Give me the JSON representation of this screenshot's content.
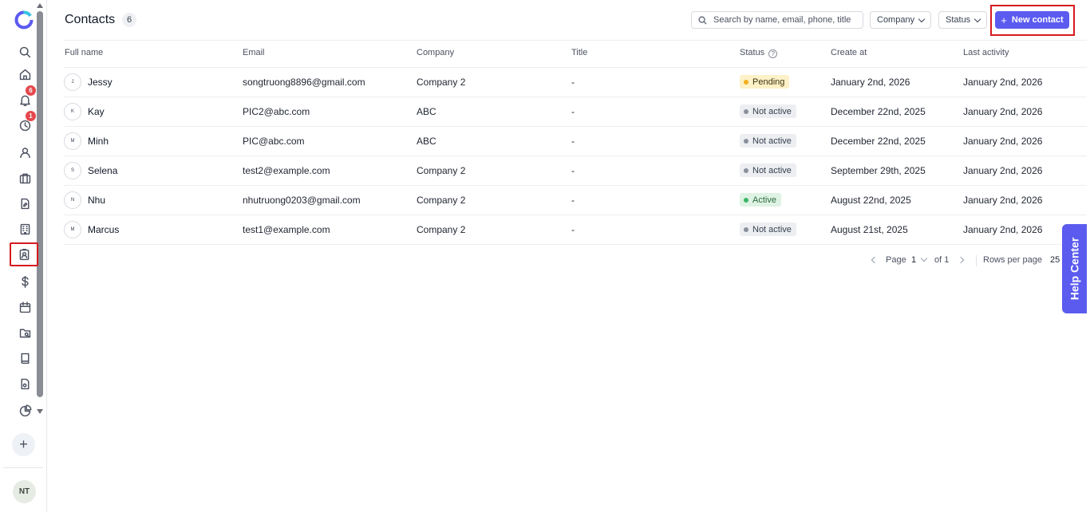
{
  "header": {
    "title": "Contacts",
    "count": "6",
    "search_placeholder": "Search by name, email, phone, title",
    "company_filter": "Company",
    "status_filter": "Status",
    "new_contact": "New contact"
  },
  "sidebar": {
    "notifications_badge": "6",
    "history_badge": "1",
    "add_label": "+",
    "user_initials": "NT"
  },
  "columns": [
    "Full name",
    "Email",
    "Company",
    "Title",
    "Status",
    "Create at",
    "Last activity"
  ],
  "rows": [
    {
      "initial": "J",
      "name": "Jessy",
      "email": "songtruong8896@gmail.com",
      "company": "Company 2",
      "title": "-",
      "status": "Pending",
      "created": "January 2nd, 2026",
      "last": "January 2nd, 2026"
    },
    {
      "initial": "K",
      "name": "Kay",
      "email": "PIC2@abc.com",
      "company": "ABC",
      "title": "-",
      "status": "Not active",
      "created": "December 22nd, 2025",
      "last": "January 2nd, 2026"
    },
    {
      "initial": "M",
      "name": "Minh",
      "email": "PIC@abc.com",
      "company": "ABC",
      "title": "-",
      "status": "Not active",
      "created": "December 22nd, 2025",
      "last": "January 2nd, 2026"
    },
    {
      "initial": "S",
      "name": "Selena",
      "email": "test2@example.com",
      "company": "Company 2",
      "title": "-",
      "status": "Not active",
      "created": "September 29th, 2025",
      "last": "January 2nd, 2026"
    },
    {
      "initial": "N",
      "name": "Nhu",
      "email": "nhutruong0203@gmail.com",
      "company": "Company 2",
      "title": "-",
      "status": "Active",
      "created": "August 22nd, 2025",
      "last": "January 2nd, 2026"
    },
    {
      "initial": "M",
      "name": "Marcus",
      "email": "test1@example.com",
      "company": "Company 2",
      "title": "-",
      "status": "Not active",
      "created": "August 21st, 2025",
      "last": "January 2nd, 2026"
    }
  ],
  "status_colors": {
    "Pending": {
      "bg": "#fdf1c7",
      "dot": "#f2b01e",
      "text": "#3d3510"
    },
    "Not active": {
      "bg": "#eceef1",
      "dot": "#8a909b",
      "text": "#374151"
    },
    "Active": {
      "bg": "#dff3e4",
      "dot": "#3cb569",
      "text": "#2d6b41"
    }
  },
  "pagination": {
    "page_label": "Page",
    "page": "1",
    "of_label": "of 1",
    "rows_label": "Rows per page",
    "rows_value": "25"
  },
  "help_center": "Help Center",
  "accent": "#5b5bf0"
}
